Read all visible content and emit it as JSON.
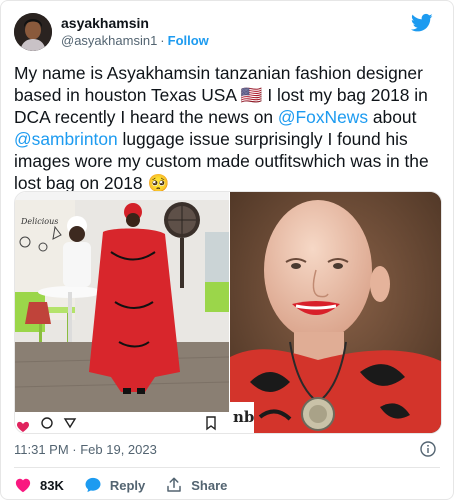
{
  "user": {
    "display_name": "asyakhamsin",
    "handle": "@asyakhamsin1",
    "separator": "·",
    "follow_label": "Follow"
  },
  "tweet": {
    "part1": "My name is Asyakhamsin tanzanian fashion designer based in houston Texas USA ",
    "flag": "🇺🇸",
    "part2": " I lost my bag 2018 in DCA  recently I heard the news on ",
    "mention1": "@FoxNews",
    "part3": "  about ",
    "mention2": "@sambrinton",
    "part4": " luggage issue surprisingly I found his images wore my custom made outfitswhich  was in the lost bag on 2018 ",
    "emoji": "🥺"
  },
  "media": {
    "left_sign_text": "Delicious",
    "right_watermark": "nb"
  },
  "timestamp": "11:31 PM · Feb 19, 2023",
  "actions": {
    "like_count": "83K",
    "reply_label": "Reply",
    "share_label": "Share"
  },
  "colors": {
    "accent": "#1d9bf0",
    "like": "#f91880",
    "text": "#0f1419",
    "muted": "#536471"
  }
}
